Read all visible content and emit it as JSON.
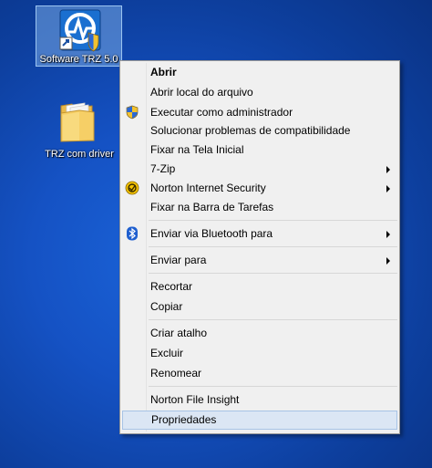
{
  "desktop": {
    "icons": [
      {
        "label": "Software TRZ 5.0",
        "icon": "trz-app-shortcut-icon",
        "selected": true
      },
      {
        "label": "TRZ com driver",
        "icon": "folder-icon"
      }
    ]
  },
  "context_menu": {
    "items": [
      {
        "label": "Abrir",
        "bold": true
      },
      {
        "label": "Abrir local do arquivo"
      },
      {
        "label": "Executar como administrador",
        "icon": "uac-shield-icon"
      },
      {
        "label": "Solucionar problemas de compatibilidade"
      },
      {
        "label": "Fixar na Tela Inicial"
      },
      {
        "label": "7-Zip",
        "submenu": true
      },
      {
        "label": "Norton Internet Security",
        "icon": "norton-icon",
        "submenu": true
      },
      {
        "label": "Fixar na Barra de Tarefas"
      },
      {
        "label": "Enviar via Bluetooth para",
        "icon": "bluetooth-icon",
        "submenu": true
      },
      {
        "label": "Enviar para",
        "submenu": true
      },
      {
        "label": "Recortar"
      },
      {
        "label": "Copiar"
      },
      {
        "label": "Criar atalho"
      },
      {
        "label": "Excluir"
      },
      {
        "label": "Renomear"
      },
      {
        "label": "Norton File Insight"
      },
      {
        "label": "Propriedades",
        "highlighted": true
      }
    ]
  },
  "colors": {
    "desktop_bg": "#1552c4",
    "menu_bg": "#f0f0f0",
    "highlight_bg": "#dbe6f4",
    "highlight_border": "#a7c3e6"
  }
}
